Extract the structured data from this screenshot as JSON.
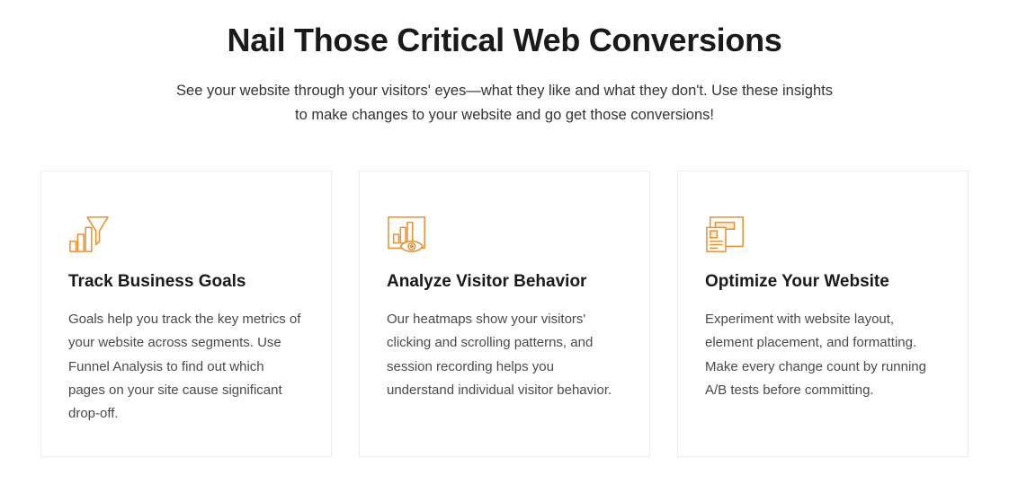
{
  "heading": "Nail Those Critical Web Conversions",
  "subheading": "See your website through your visitors' eyes—what they like and what they don't. Use these insights to make changes to your website and go get those conversions!",
  "cards": [
    {
      "icon": "funnel-chart-icon",
      "title": "Track Business Goals",
      "text": "Goals help you track the key metrics of your website across segments. Use Funnel Analysis to find out which pages on your site cause significant drop-off."
    },
    {
      "icon": "chart-eye-icon",
      "title": "Analyze Visitor Behavior",
      "text": "Our heatmaps show your visitors' clicking and scrolling patterns, and session recording helps you understand individual visitor behavior."
    },
    {
      "icon": "layout-optimize-icon",
      "title": "Optimize Your Website",
      "text": "Experiment with website layout, element placement, and formatting. Make every change count by running A/B tests before committing."
    }
  ],
  "colors": {
    "accent": "#e6922e"
  }
}
